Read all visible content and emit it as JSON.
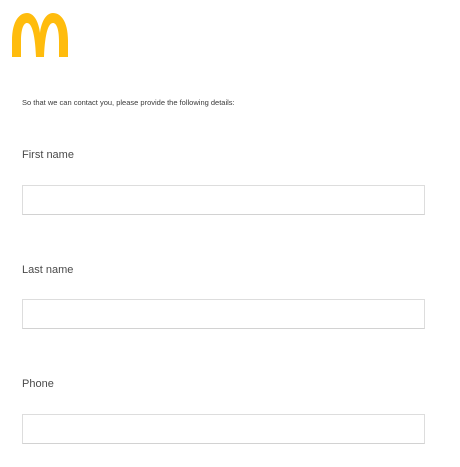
{
  "brand": {
    "logo_icon": "mcdonalds-golden-arches-logo",
    "logo_color": "#FFBC0D"
  },
  "form": {
    "intro": "So that we can contact you, please provide the following details:",
    "fields": [
      {
        "label": "First name",
        "value": "",
        "placeholder": ""
      },
      {
        "label": "Last name",
        "value": "",
        "placeholder": ""
      },
      {
        "label": "Phone",
        "value": "",
        "placeholder": ""
      }
    ]
  }
}
